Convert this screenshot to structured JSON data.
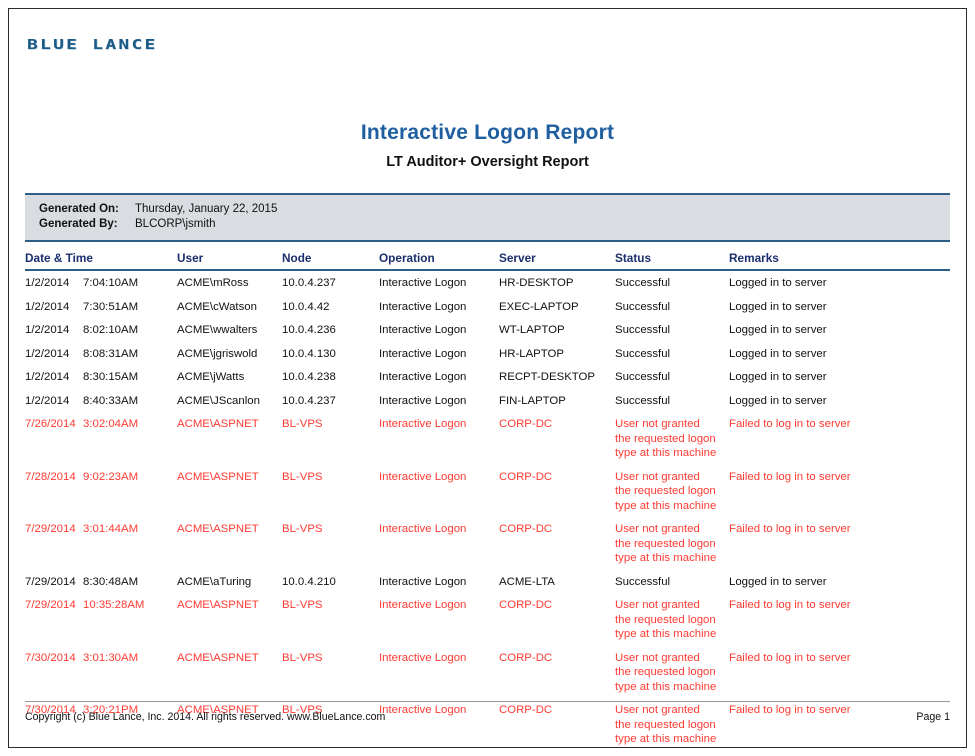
{
  "branding": {
    "logo_text": "BLUE LANCE",
    "logo_color": "#1c5a86"
  },
  "header": {
    "title": "Interactive Logon Report",
    "subtitle": "LT Auditor+ Oversight Report",
    "title_color": "#1f5fa0"
  },
  "generated": {
    "on_label": "Generated On:",
    "on_value": "Thursday, January 22, 2015",
    "by_label": "Generated By:",
    "by_value": "BLCORP\\jsmith",
    "band_color": "#d9dce0",
    "rule_color": "#2e5f86"
  },
  "table": {
    "columns": [
      "Date & Time",
      "User",
      "Node",
      "Operation",
      "Server",
      "Status",
      "Remarks"
    ],
    "header_color": "#1b2f6e",
    "failed_color": "#ff3b33",
    "rows": [
      {
        "date": "1/2/2014",
        "time": "7:04:10AM",
        "user": "ACME\\mRoss",
        "node": "10.0.4.237",
        "operation": "Interactive Logon",
        "server": "HR-DESKTOP",
        "status": [
          "Successful"
        ],
        "remarks": "Logged in to server",
        "failed": false
      },
      {
        "date": "1/2/2014",
        "time": "7:30:51AM",
        "user": "ACME\\cWatson",
        "node": "10.0.4.42",
        "operation": "Interactive Logon",
        "server": "EXEC-LAPTOP",
        "status": [
          "Successful"
        ],
        "remarks": "Logged in to server",
        "failed": false
      },
      {
        "date": "1/2/2014",
        "time": "8:02:10AM",
        "user": "ACME\\wwalters",
        "node": "10.0.4.236",
        "operation": "Interactive Logon",
        "server": "WT-LAPTOP",
        "status": [
          "Successful"
        ],
        "remarks": "Logged in to server",
        "failed": false
      },
      {
        "date": "1/2/2014",
        "time": "8:08:31AM",
        "user": "ACME\\jgriswold",
        "node": "10.0.4.130",
        "operation": "Interactive Logon",
        "server": "HR-LAPTOP",
        "status": [
          "Successful"
        ],
        "remarks": "Logged in to server",
        "failed": false
      },
      {
        "date": "1/2/2014",
        "time": "8:30:15AM",
        "user": "ACME\\jWatts",
        "node": "10.0.4.238",
        "operation": "Interactive Logon",
        "server": "RECPT-DESKTOP",
        "status": [
          "Successful"
        ],
        "remarks": "Logged in to server",
        "failed": false
      },
      {
        "date": "1/2/2014",
        "time": "8:40:33AM",
        "user": "ACME\\JScanlon",
        "node": "10.0.4.237",
        "operation": "Interactive Logon",
        "server": "FIN-LAPTOP",
        "status": [
          "Successful"
        ],
        "remarks": "Logged in to server",
        "failed": false
      },
      {
        "date": "7/26/2014",
        "time": "3:02:04AM",
        "user": "ACME\\ASPNET",
        "node": "BL-VPS",
        "operation": "Interactive Logon",
        "server": "CORP-DC",
        "status": [
          "User not granted",
          "the requested logon",
          "type at this machine"
        ],
        "remarks": "Failed to log in to server",
        "failed": true
      },
      {
        "date": "7/28/2014",
        "time": "9:02:23AM",
        "user": "ACME\\ASPNET",
        "node": "BL-VPS",
        "operation": "Interactive Logon",
        "server": "CORP-DC",
        "status": [
          "User not granted",
          "the requested logon",
          "type at this machine"
        ],
        "remarks": "Failed to log in to server",
        "failed": true
      },
      {
        "date": "7/29/2014",
        "time": "3:01:44AM",
        "user": "ACME\\ASPNET",
        "node": "BL-VPS",
        "operation": "Interactive Logon",
        "server": "CORP-DC",
        "status": [
          "User not granted",
          "the requested logon",
          "type at this machine"
        ],
        "remarks": "Failed to log in to server",
        "failed": true
      },
      {
        "date": "7/29/2014",
        "time": "8:30:48AM",
        "user": "ACME\\aTuring",
        "node": "10.0.4.210",
        "operation": "Interactive Logon",
        "server": "ACME-LTA",
        "status": [
          "Successful"
        ],
        "remarks": "Logged in to server",
        "failed": false
      },
      {
        "date": "7/29/2014",
        "time": "10:35:28AM",
        "user": "ACME\\ASPNET",
        "node": "BL-VPS",
        "operation": "Interactive Logon",
        "server": "CORP-DC",
        "status": [
          "User not granted",
          "the requested logon",
          "type at this machine"
        ],
        "remarks": "Failed to log in to server",
        "failed": true
      },
      {
        "date": "7/30/2014",
        "time": "3:01:30AM",
        "user": "ACME\\ASPNET",
        "node": "BL-VPS",
        "operation": "Interactive Logon",
        "server": "CORP-DC",
        "status": [
          "User not granted",
          "the requested logon",
          "type at this machine"
        ],
        "remarks": "Failed to log in to server",
        "failed": true
      },
      {
        "date": "7/30/2014",
        "time": "3:20:21PM",
        "user": "ACME\\ASPNET",
        "node": "BL-VPS",
        "operation": "Interactive Logon",
        "server": "CORP-DC",
        "status": [
          "User not granted",
          "the requested logon",
          "type at this machine"
        ],
        "remarks": "Failed to log in to server",
        "failed": true
      }
    ]
  },
  "footer": {
    "copyright": "Copyright (c) Blue Lance, Inc. 2014. All rights reserved. www.BlueLance.com",
    "page": "Page 1"
  }
}
